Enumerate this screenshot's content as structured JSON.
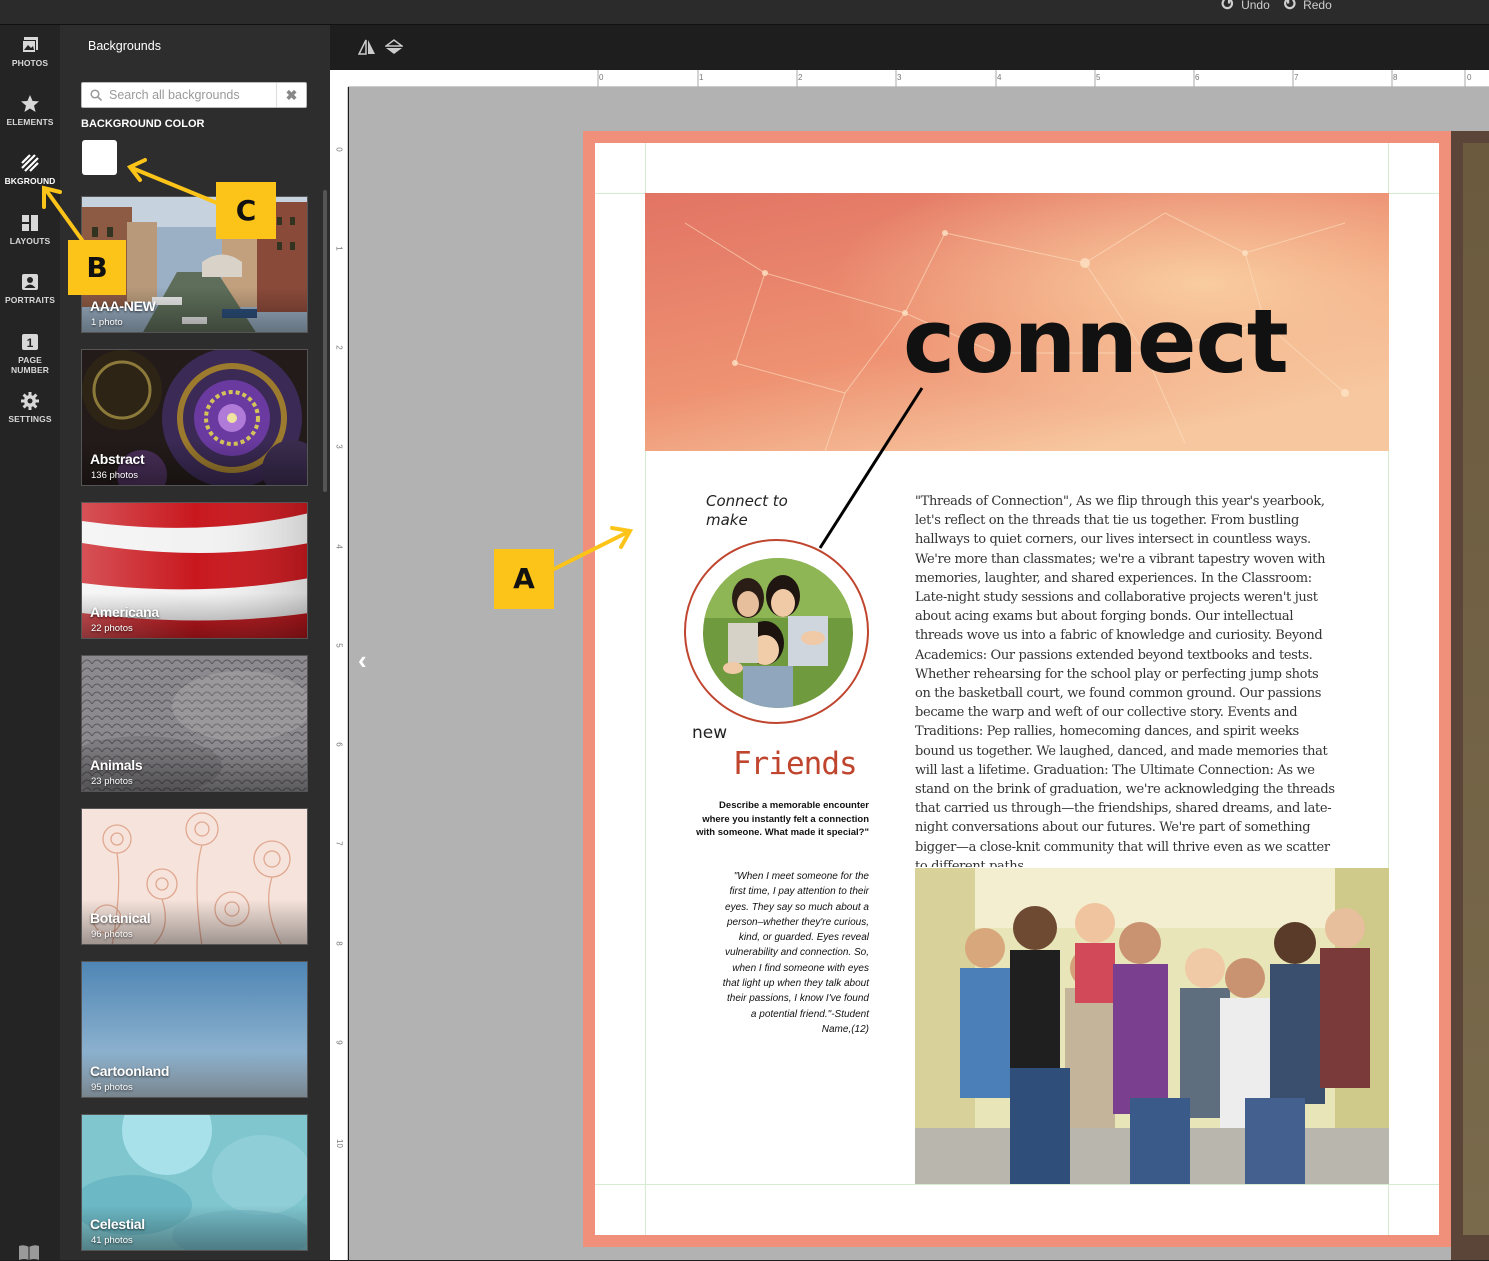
{
  "topbar": {
    "undo_label": "Undo",
    "redo_label": "Redo"
  },
  "rail": [
    {
      "label": "PHOTOS",
      "icon": "photos-icon"
    },
    {
      "label": "ELEMENTS",
      "icon": "star-icon"
    },
    {
      "label": "BKGROUND",
      "icon": "background-stripes-icon",
      "active": true
    },
    {
      "label": "LAYOUTS",
      "icon": "layouts-icon"
    },
    {
      "label": "PORTRAITS",
      "icon": "portrait-icon"
    },
    {
      "label_line1": "PAGE",
      "label_line2": "NUMBER",
      "icon": "page-number-icon",
      "icon_text": "1"
    },
    {
      "label": "SETTINGS",
      "icon": "gear-icon"
    }
  ],
  "panel": {
    "title": "Backgrounds",
    "search_placeholder": "Search all backgrounds",
    "clear_glyph": "✖",
    "background_color_label": "BACKGROUND COLOR",
    "swatch_color": "#ffffff",
    "categories": [
      {
        "name": "AAA-NEW",
        "count": "1 photo"
      },
      {
        "name": "Abstract",
        "count": "136 photos"
      },
      {
        "name": "Americana",
        "count": "22 photos"
      },
      {
        "name": "Animals",
        "count": "23 photos"
      },
      {
        "name": "Botanical",
        "count": "96 photos"
      },
      {
        "name": "Cartoonland",
        "count": "95 photos"
      },
      {
        "name": "Celestial",
        "count": "41 photos"
      }
    ]
  },
  "ruler": {
    "top_ticks": [
      "0",
      "1",
      "2",
      "3",
      "4",
      "5",
      "6",
      "7",
      "8",
      "0"
    ],
    "left_ticks": [
      "0",
      "1",
      "2",
      "3",
      "4",
      "5",
      "6",
      "7",
      "8",
      "9",
      "10"
    ]
  },
  "page": {
    "border_color": "#f0907a",
    "headline": "connect",
    "connect_to": "Connect to make",
    "new": "new",
    "friends": "Friends",
    "prompt": "Describe a memorable encounter where you instantly felt a connection with someone. What made it special?\"",
    "quote": "\"When I meet someone for the first time, I pay attention to their eyes. They say so much about a person–whether they're curious, kind, or guarded. Eyes reveal vulnerability and connection. So, when I find someone with eyes that light up when they talk about their passions, I know I've found a potential friend.\"-Student Name,(12)",
    "body": "\"Threads of Connection\", As we flip through this year's yearbook, let's reflect on the threads that tie us together. From bustling hallways to quiet corners, our lives intersect in countless ways. We're more than classmates; we're a vibrant tapestry woven with memories, laughter, and shared experiences. In the Classroom: Late-night study sessions and collaborative projects weren't just about acing exams but about forging bonds. Our intellectual threads wove us into a fabric of knowledge and curiosity. Beyond Academics: Our passions extended beyond textbooks and tests. Whether rehearsing for the school play or perfecting jump shots on the basketball court, we found common ground. Our passions became the warp and weft of our collective story. Events and Traditions: Pep rallies, homecoming dances, and spirit weeks bound us together. We laughed, danced, and made memories that will last a lifetime. Graduation: The Ultimate Connection: As we stand on the brink of graduation, we're acknowledging the threads that carried us through—the friendships, shared dreams, and late-night conversations about our futures. We're part of something bigger—a close-knit community that will thrive even as we scatter to different paths."
  },
  "annotations": {
    "a": "A",
    "b": "B",
    "c": "C",
    "color": "#fcc419"
  }
}
